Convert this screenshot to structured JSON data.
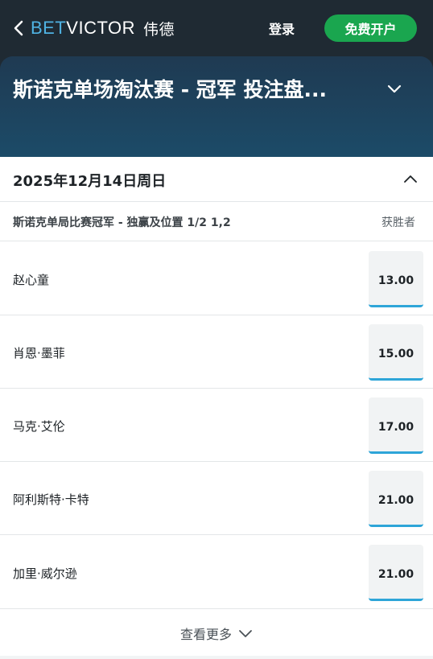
{
  "header": {
    "logo_bet": "BET",
    "logo_victor": "VICTOR",
    "logo_cn": "伟德",
    "login_label": "登录",
    "signup_label": "免费开户"
  },
  "hero": {
    "title": "斯诺克单场淘汰赛 - 冠军 投注盘..."
  },
  "event": {
    "date": "2025年12月14日周日",
    "market_title": "斯诺克单局比赛冠军 - 独赢及位置 1/2 1,2",
    "column_label": "获胜者",
    "runners": [
      {
        "name": "赵心童",
        "odds": "13.00"
      },
      {
        "name": "肖恩·墨菲",
        "odds": "15.00"
      },
      {
        "name": "马克·艾伦",
        "odds": "17.00"
      },
      {
        "name": "阿利斯特·卡特",
        "odds": "21.00"
      },
      {
        "name": "加里·威尔逊",
        "odds": "21.00"
      }
    ],
    "show_more_label": "查看更多"
  },
  "colors": {
    "header_bg": "#1f2a33",
    "hero_bg": "#1c4b68",
    "brand_blue": "#4fb3e3",
    "signup_green": "#1aa64f",
    "odds_underline": "#2ea5d8"
  },
  "icons": {
    "back": "chevron-left-icon",
    "hero_toggle": "chevron-down-icon",
    "date_toggle": "chevron-up-icon",
    "show_more": "chevron-down-icon"
  }
}
